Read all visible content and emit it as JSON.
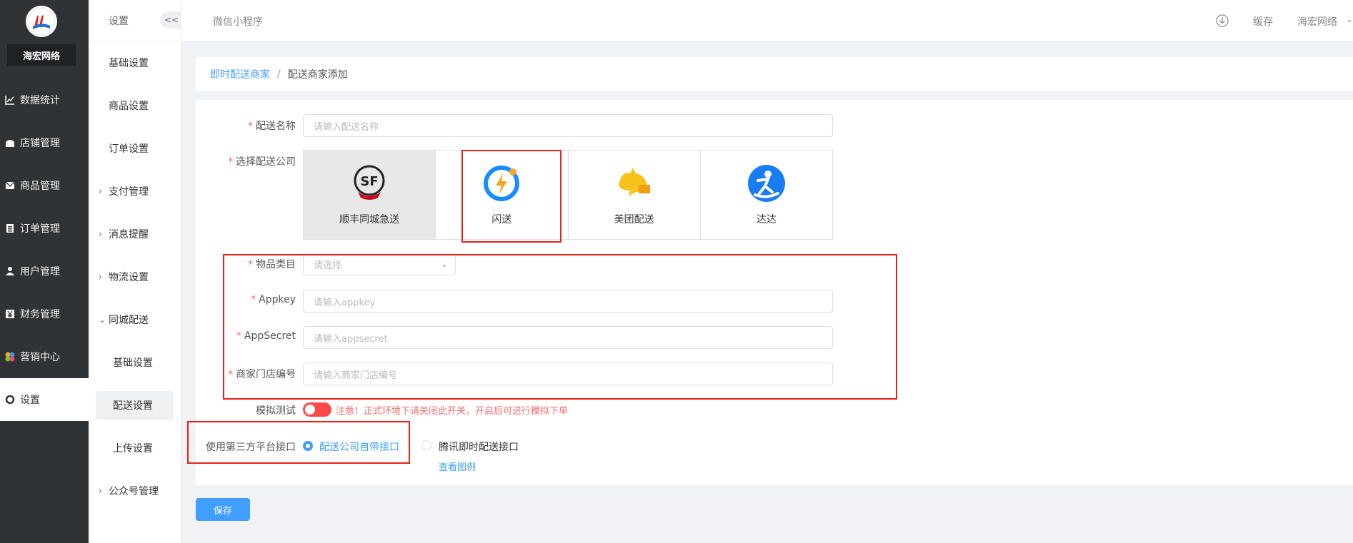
{
  "colors": {
    "accent": "#409eff",
    "danger": "#f56c6c",
    "highlight_box": "#e62117",
    "sidebar_bg": "#2f3336"
  },
  "brand": {
    "name": "海宏网络"
  },
  "sidebar": {
    "items": [
      {
        "label": "数据统计",
        "icon": "line-chart-icon"
      },
      {
        "label": "店铺管理",
        "icon": "store-icon"
      },
      {
        "label": "商品管理",
        "icon": "mail-icon"
      },
      {
        "label": "订单管理",
        "icon": "clipboard-icon"
      },
      {
        "label": "用户管理",
        "icon": "user-icon"
      },
      {
        "label": "财务管理",
        "icon": "yen-icon"
      },
      {
        "label": "营销中心",
        "icon": "marketing-icon"
      },
      {
        "label": "设置",
        "icon": "gear-icon",
        "active": true
      }
    ]
  },
  "submenu": {
    "header": "设置",
    "collapse_label": "<<",
    "items": [
      {
        "label": "基础设置"
      },
      {
        "label": "商品设置"
      },
      {
        "label": "订单设置"
      },
      {
        "label": "支付管理",
        "chevron": "›"
      },
      {
        "label": "消息提醒",
        "chevron": "›"
      },
      {
        "label": "物流设置",
        "chevron": "›"
      },
      {
        "label": "同城配送",
        "chevron": "⌄"
      },
      {
        "label": "基础设置",
        "child": true
      },
      {
        "label": "配送设置",
        "child": true,
        "selected": true
      },
      {
        "label": "上传设置",
        "child": true
      },
      {
        "label": "公众号管理",
        "chevron": "›"
      }
    ]
  },
  "topbar": {
    "title": "微信小程序",
    "cache": "缓存",
    "user": "海宏网络"
  },
  "breadcrumb": {
    "parent": "即时配送商家",
    "sep": "/",
    "current": "配送商家添加"
  },
  "form": {
    "name_label": "配送名称",
    "name_placeholder": "请输入配送名称",
    "company_label": "选择配送公司",
    "companies": [
      {
        "name": "顺丰同城急送",
        "logo_text": "SF"
      },
      {
        "name": "闪送"
      },
      {
        "name": "美团配送"
      },
      {
        "name": "达达"
      }
    ],
    "category_label": "物品类目",
    "category_placeholder": "请选择",
    "appkey_label": "Appkey",
    "appkey_placeholder": "请输入appkey",
    "appsecret_label": "AppSecret",
    "appsecret_placeholder": "请输入appsecret",
    "store_label": "商家门店编号",
    "store_placeholder": "请输入商家门店编号",
    "sim_label": "模拟测试",
    "sim_warning": "注意！正式环境下请关闭此开关，开启后可进行模拟下单",
    "third_label": "使用第三方平台接口",
    "radio_1": "配送公司自带接口",
    "radio_2": "腾讯即时配送接口",
    "view_example": "查看图例",
    "save": "保存"
  }
}
